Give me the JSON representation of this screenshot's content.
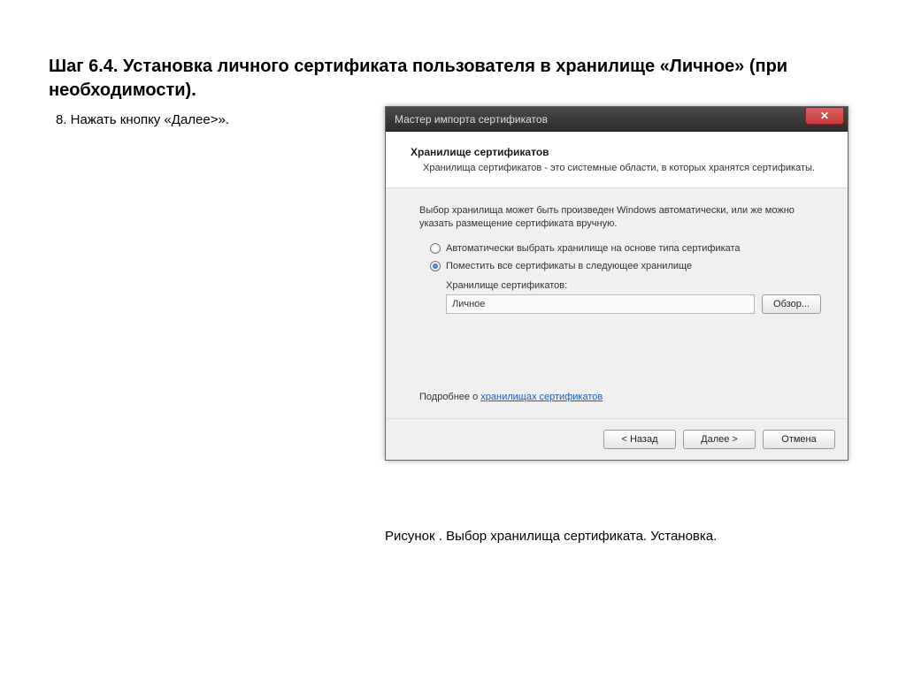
{
  "heading": "Шаг 6.4. Установка личного сертификата пользователя в хранилище «Личное» (при необходимости).",
  "instruction": "8. Нажать кнопку «Далее>».",
  "window": {
    "title": "Мастер импорта сертификатов",
    "section_title": "Хранилище сертификатов",
    "section_sub": "Хранилища сертификатов - это системные области, в которых хранятся сертификаты.",
    "body_text": "Выбор хранилища может быть произведен Windows автоматически, или же можно указать размещение сертификата вручную.",
    "radio_auto": "Автоматически выбрать хранилище на основе типа сертификата",
    "radio_place": "Поместить все сертификаты в следующее хранилище",
    "store_label": "Хранилище сертификатов:",
    "store_value": "Личное",
    "browse": "Обзор...",
    "more_prefix": "Подробнее о ",
    "more_link": "хранилищах сертификатов",
    "back": "< Назад",
    "next": "Далее >",
    "cancel": "Отмена"
  },
  "caption": "Рисунок . Выбор хранилища сертификата. Установка."
}
